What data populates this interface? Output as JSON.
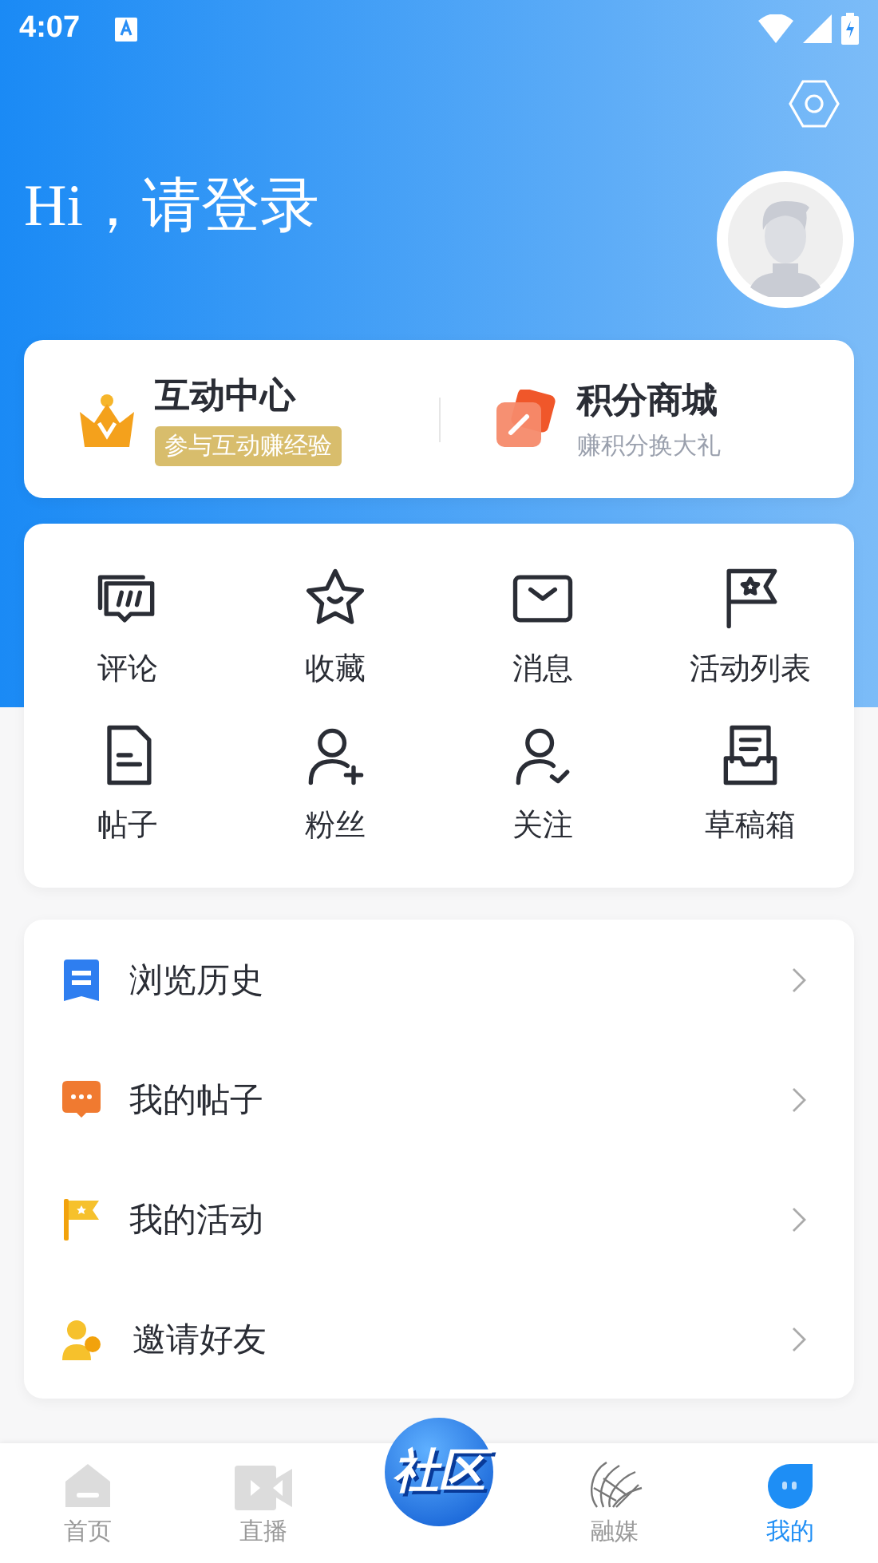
{
  "status_bar": {
    "time": "4:07"
  },
  "header": {
    "greeting": "Hi，请登录"
  },
  "promo_cards": [
    {
      "kind": "crown",
      "title": "互动中心",
      "subtitle": "参与互动赚经验"
    },
    {
      "kind": "pencil",
      "title": "积分商城",
      "subtitle": "赚积分换大礼"
    }
  ],
  "shortcuts": [
    {
      "kind": "comment",
      "label": "评论"
    },
    {
      "kind": "star",
      "label": "收藏"
    },
    {
      "kind": "mail",
      "label": "消息"
    },
    {
      "kind": "flag",
      "label": "活动列表"
    },
    {
      "kind": "doc",
      "label": "帖子"
    },
    {
      "kind": "user-add",
      "label": "粉丝"
    },
    {
      "kind": "user-check",
      "label": "关注"
    },
    {
      "kind": "inbox",
      "label": "草稿箱"
    }
  ],
  "menu": [
    {
      "kind": "history",
      "label": "浏览历史"
    },
    {
      "kind": "posts",
      "label": "我的帖子"
    },
    {
      "kind": "activity",
      "label": "我的活动"
    },
    {
      "kind": "invite",
      "label": "邀请好友"
    }
  ],
  "tabs": [
    {
      "kind": "home",
      "label": "首页",
      "selected": false
    },
    {
      "kind": "live",
      "label": "直播",
      "selected": false
    },
    {
      "kind": "community",
      "label": "社区",
      "selected": false
    },
    {
      "kind": "media",
      "label": "融媒",
      "selected": false
    },
    {
      "kind": "mine",
      "label": "我的",
      "selected": true
    }
  ]
}
